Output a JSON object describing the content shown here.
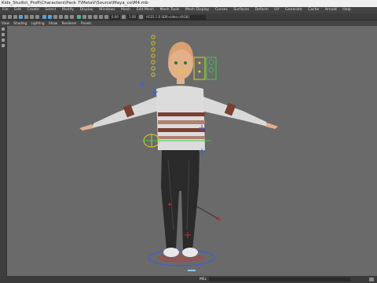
{
  "window": {
    "title": "Kids_Studio\\_Profi\\Characters\\Pack 7\\MetaV\\Source\\Maya_co\\M4.mb"
  },
  "menubar": {
    "items": [
      "File",
      "Edit",
      "Create",
      "Select",
      "Modify",
      "Display",
      "Windows",
      "Mesh",
      "Edit Mesh",
      "Mesh Tools",
      "Mesh Display",
      "Curves",
      "Surfaces",
      "Deform",
      "UV",
      "Generate",
      "Cache",
      "Arnold",
      "Help"
    ]
  },
  "shelf": {
    "time_field": "0.00",
    "scale_field": "1.00",
    "renderer": "ACES 1.0 SDR-video (sRGB)"
  },
  "panel_menu": {
    "items": [
      "View",
      "Shading",
      "Lighting",
      "Show",
      "Renderer",
      "Panels"
    ]
  },
  "command_line": {
    "label": "MEL"
  },
  "colors": {
    "viewport_bg": "#6a6a6a",
    "control_yellow": "#e0d020",
    "control_blue": "#3a5fd8",
    "control_green": "#36d04a",
    "control_red": "#e02020"
  }
}
